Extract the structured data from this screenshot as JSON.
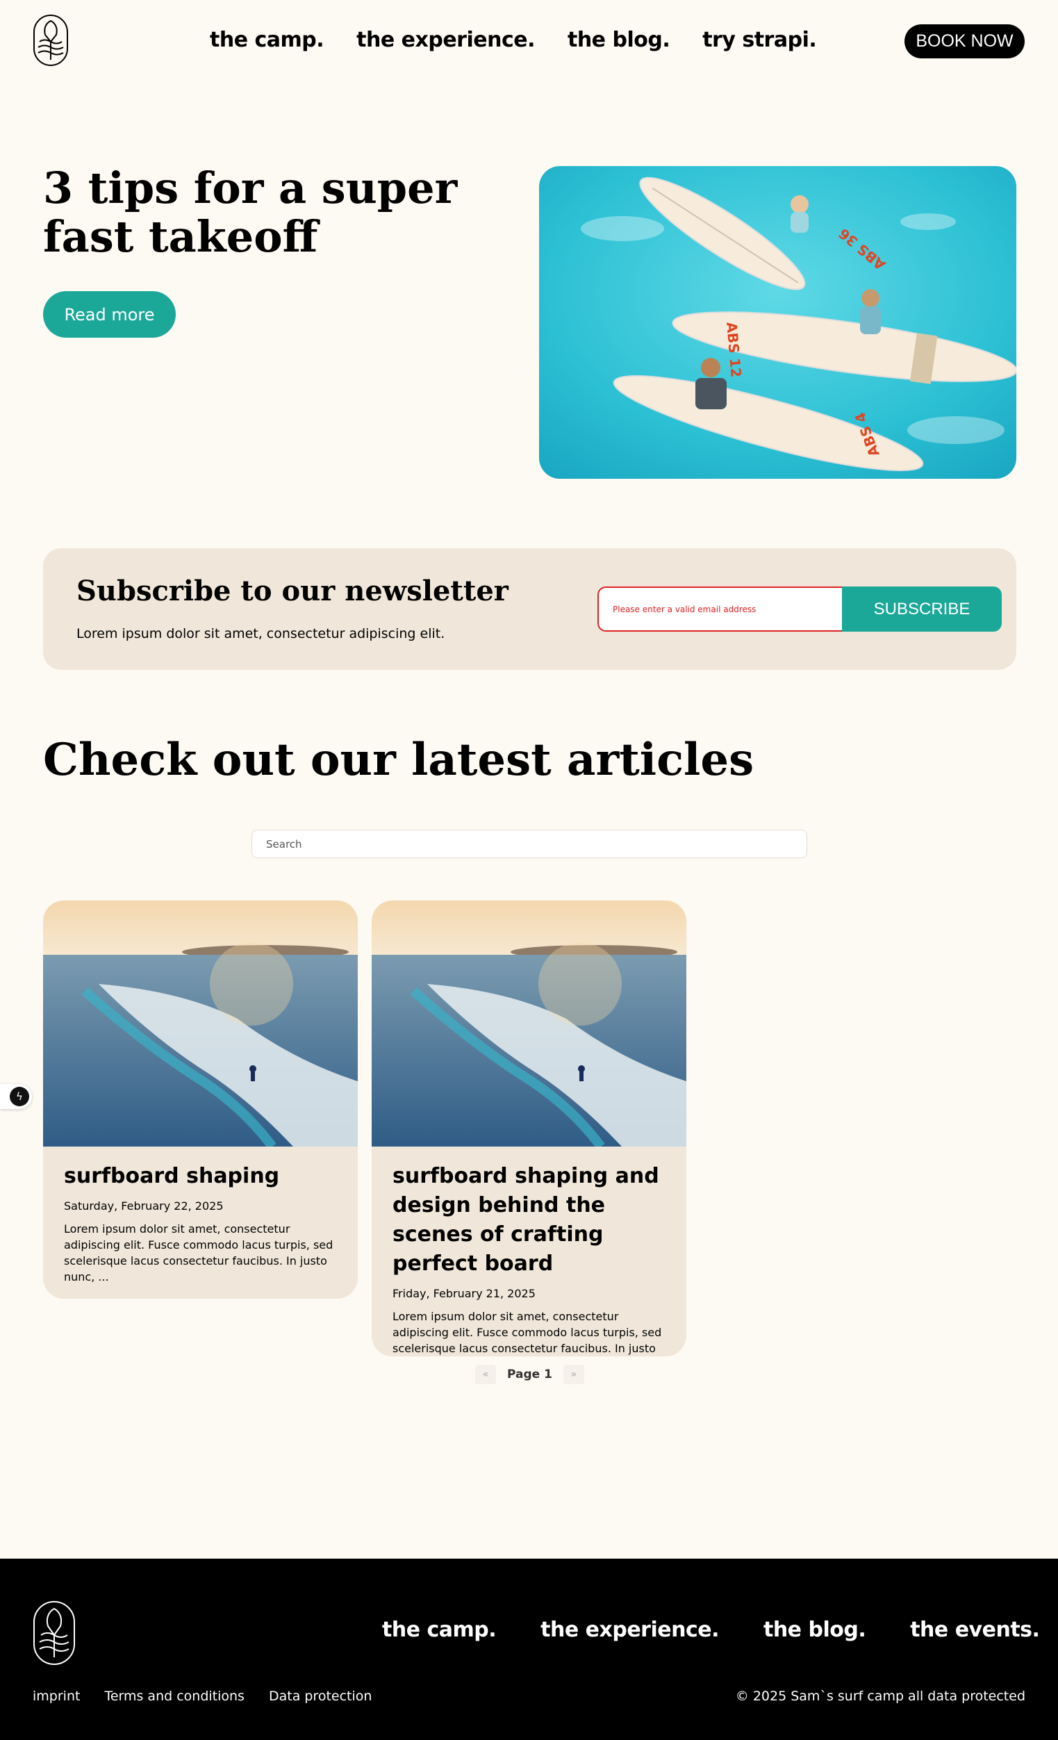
{
  "header": {
    "nav": [
      "the camp.",
      "the experience.",
      "the blog.",
      "try strapi."
    ],
    "book_label": "BOOK NOW"
  },
  "hero": {
    "title": "3 tips for a super fast takeoff",
    "button_label": "Read more"
  },
  "newsletter": {
    "title": "Subscribe to our newsletter",
    "text": "Lorem ipsum dolor sit amet, consectetur adipiscing elit.",
    "input_error": "Please enter a valid email address",
    "button_label": "SUBSCRIBE"
  },
  "articles": {
    "title": "Check out our latest articles",
    "search_placeholder": "Search",
    "cards": [
      {
        "title": "surfboard shaping",
        "date": "Saturday, February 22, 2025",
        "excerpt": "Lorem ipsum dolor sit amet, consectetur adipiscing elit. Fusce commodo lacus turpis, sed scelerisque lacus consectetur faucibus. In justo nunc, ..."
      },
      {
        "title": "surfboard shaping and design behind the scenes of crafting perfect board",
        "date": "Friday, February 21, 2025",
        "excerpt": "Lorem ipsum dolor sit amet, consectetur adipiscing elit. Fusce commodo lacus turpis, sed scelerisque lacus consectetur faucibus. In justo nunc, ..."
      }
    ],
    "pager": {
      "prev": "«",
      "label": "Page 1",
      "next": "»"
    }
  },
  "footer": {
    "nav": [
      "the camp.",
      "the experience.",
      "the blog.",
      "the events."
    ],
    "links": [
      "imprint",
      "Terms and conditions",
      "Data protection"
    ],
    "copyright": "© 2025 Sam`s surf camp all data protected"
  },
  "colors": {
    "accent": "#1ca898",
    "background": "#fdf9f3",
    "panel": "#f0e7da",
    "error": "#e02020"
  },
  "icons": {
    "logo": "surf-logo-icon",
    "side": "bolt-icon"
  }
}
